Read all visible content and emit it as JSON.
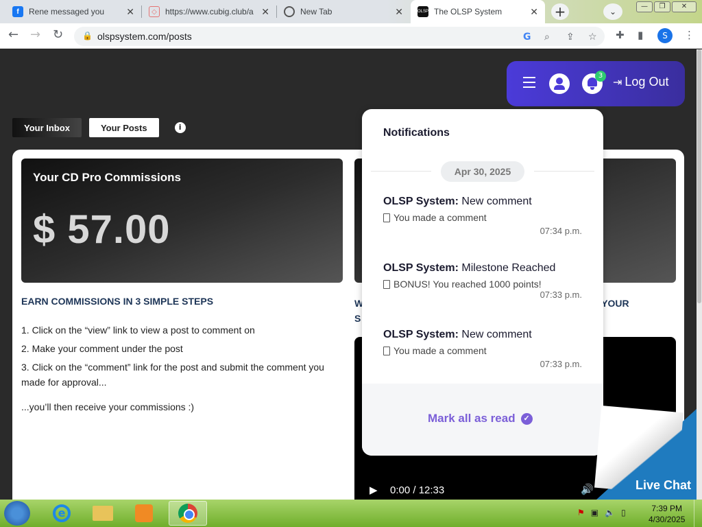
{
  "browser": {
    "tabs": [
      {
        "label": "Rene messaged you",
        "icon": "facebook-icon"
      },
      {
        "label": "https://www.cubig.club/a",
        "icon": "cubig-icon"
      },
      {
        "label": "New Tab",
        "icon": "chrome-icon"
      },
      {
        "label": "The OLSP System",
        "icon": "olsp-icon",
        "active": true
      }
    ],
    "url": "olspsystem.com/posts",
    "profile_initial": "S"
  },
  "page": {
    "nav": {
      "logout_label": "Log Out",
      "notification_count": "3"
    },
    "tabs": {
      "inbox": "Your Inbox",
      "posts": "Your Posts"
    },
    "commissions": {
      "title": "Your CD Pro Commissions",
      "value": "$ 57.00"
    },
    "steps": {
      "heading": "EARN COMMISSIONS IN 3 SIMPLE STEPS",
      "items": [
        "1. Click on the “view” link to view a post to comment on",
        "2. Make your comment under the post",
        "3. Click on the “comment” link for the post and submit the comment you made for approval..."
      ],
      "footer": "...you’ll then receive your commissions :)"
    },
    "right_heading": {
      "left_line1": "W",
      "left_line2": "S",
      "right_line1": "T YOUR"
    },
    "video": {
      "time": "0:00 / 12:33"
    },
    "notifications": {
      "heading": "Notifications",
      "date": "Apr 30, 2025",
      "items": [
        {
          "sender": "OLSP System:",
          "title": "New comment",
          "body": "You made a comment",
          "time": "07:34 p.m."
        },
        {
          "sender": "OLSP System:",
          "title": "Milestone Reached",
          "body": "BONUS! You reached 1000 points!",
          "time": "07:33 p.m."
        },
        {
          "sender": "OLSP System:",
          "title": "New comment",
          "body": "You made a comment",
          "time": "07:33 p.m."
        }
      ],
      "mark_all_label": "Mark all as read"
    },
    "live_chat": "Live Chat"
  },
  "taskbar": {
    "time": "7:39 PM",
    "date": "4/30/2025"
  },
  "colors": {
    "nav_gradient_start": "#4b3bd9",
    "accent_purple": "#7b5fd8",
    "badge_green": "#2ecc71",
    "heading_navy": "#1d3557",
    "live_chat_blue": "#1f7bbf"
  }
}
